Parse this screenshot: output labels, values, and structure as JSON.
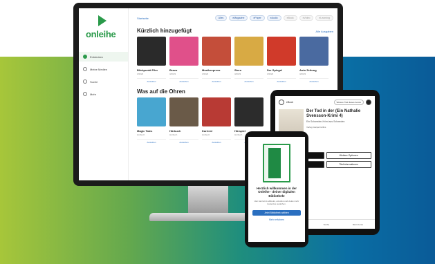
{
  "app": {
    "logo_text": "onleihe"
  },
  "sidebar": {
    "items": [
      {
        "label": "Entdecken",
        "active": true
      },
      {
        "label": "Meine Medien",
        "active": false
      },
      {
        "label": "Suche",
        "active": false
      },
      {
        "label": "Mehr",
        "active": false
      }
    ]
  },
  "main": {
    "back_link": "Startseite",
    "filters": [
      "Alles",
      "eMagazine",
      "ePaper",
      "eAudio",
      "eBook",
      "eVideo",
      "eLearning"
    ],
    "sections": [
      {
        "title": "Kürzlich hinzugefügt",
        "link": "Alle Ausgaben",
        "cards": [
          {
            "title": "Blickpunkt Film",
            "sub": "3/2023",
            "color": "#2a2a2a",
            "btn": "Ausleihen"
          },
          {
            "title": "Bravo",
            "sub": "3/2023",
            "color": "#e0508a",
            "btn": "Ausleihen"
          },
          {
            "title": "Musikexpress",
            "sub": "3/2023",
            "color": "#c44e3a",
            "btn": "Ausleihen"
          },
          {
            "title": "Stern",
            "sub": "3/2023",
            "color": "#d8aa44",
            "btn": "Ausleihen"
          },
          {
            "title": "Der Spiegel",
            "sub": "3/2023",
            "color": "#d03a2a",
            "btn": "Ausleihen"
          },
          {
            "title": "Auto Zeitung",
            "sub": "3/2023",
            "color": "#4a6aa0",
            "btn": "Ausleihen"
          }
        ]
      },
      {
        "title": "Was auf die Ohren",
        "link": "",
        "cards": [
          {
            "title": "Magic Tales",
            "sub": "Hörbuch",
            "color": "#48a6d0",
            "btn": "Ausleihen"
          },
          {
            "title": "Hörbuch",
            "sub": "Hörbuch",
            "color": "#6a5a48",
            "btn": "Ausleihen"
          },
          {
            "title": "Karrieré",
            "sub": "Hörbuch",
            "color": "#b83a34",
            "btn": "Ausleihen"
          },
          {
            "title": "Hörspiel",
            "sub": "Hörbuch",
            "color": "#2c2c2c",
            "btn": "Ausleihen"
          }
        ]
      }
    ]
  },
  "tablet": {
    "tag": "eBook",
    "pill": "Weitere Titel dieses Autors",
    "title": "Der Tod in der (Ein Nathalie Svensson-Krimi 4)",
    "author": "Ein Schweden-Krimi aus Schweden",
    "meta": "Verlag: HarperCollins",
    "btn_primary": "Ausleihen",
    "btn_secondary": "Weitere Optionen",
    "btn_tertiary": "Leseprobe",
    "btn_quaternary": "Titelinformationen",
    "nav": [
      "Meine Medien",
      "Suche",
      "Mein Konto"
    ]
  },
  "phone": {
    "title": "Herzlich willkommen in der Onleihe - deiner digitalen Bibliothek!",
    "text": "Hier kannst du eBooks, eAudios und vieles mehr kostenlos ausleihen.",
    "btn": "Jetzt Bibliothek wählen",
    "link": "Mehr erfahren"
  }
}
